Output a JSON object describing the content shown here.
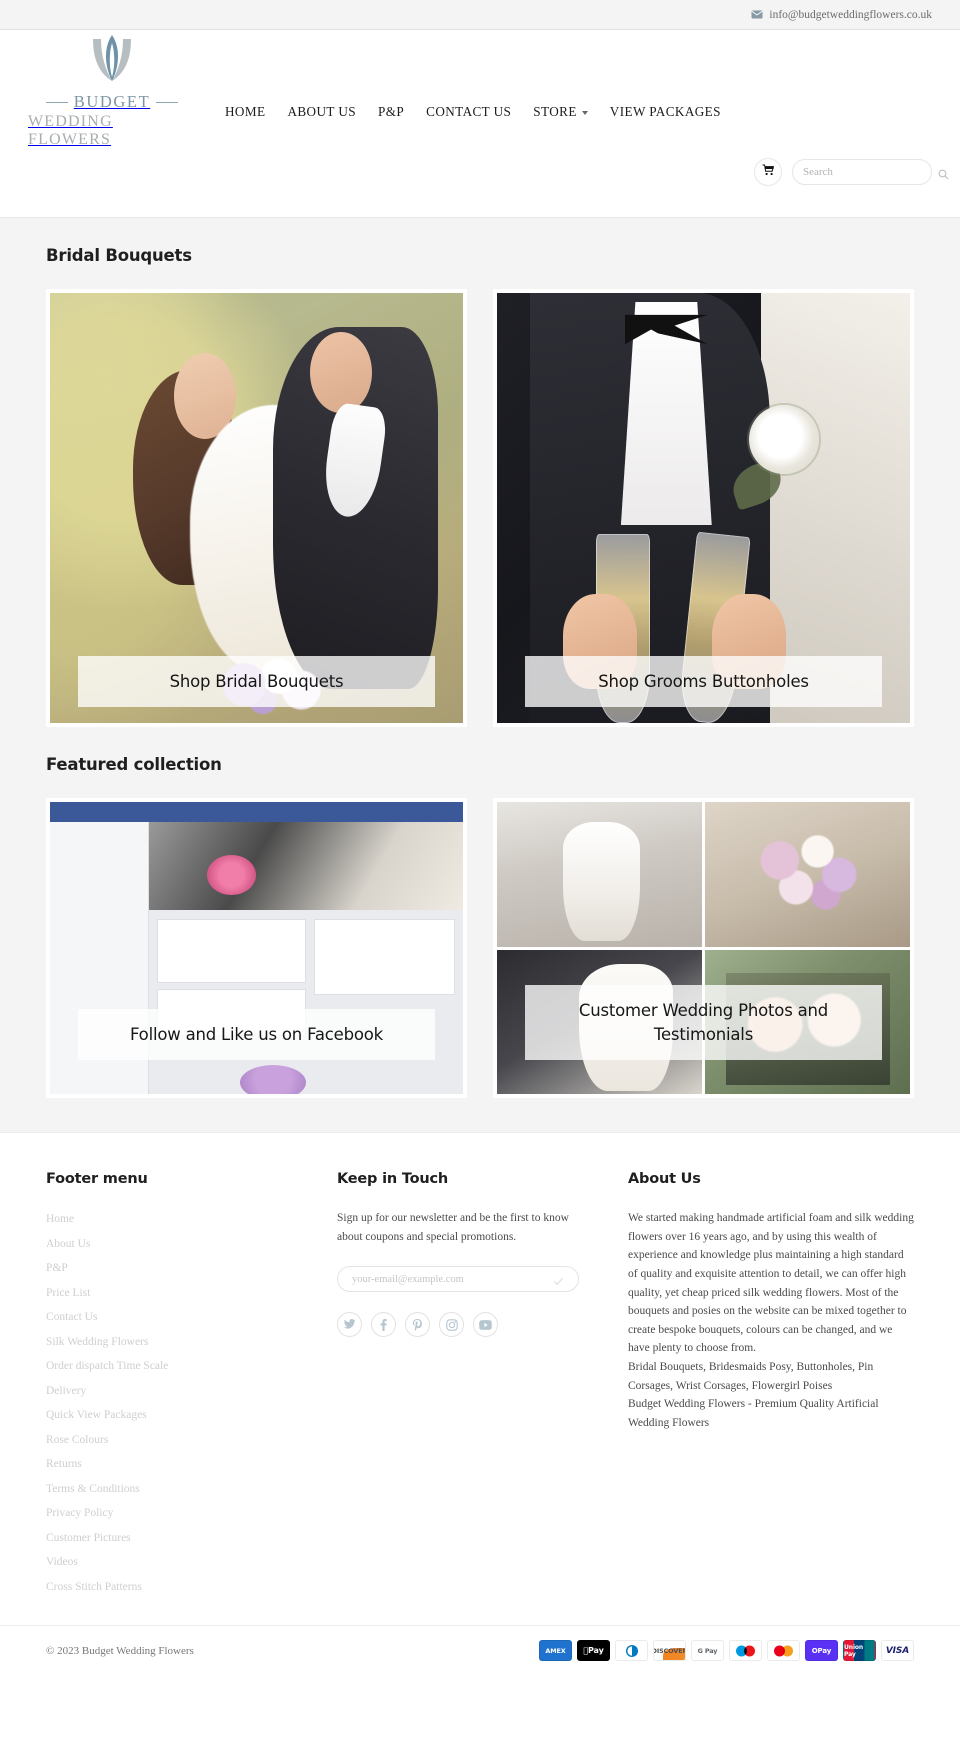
{
  "topbar": {
    "email": "info@budgetweddingflowers.co.uk",
    "mail_icon": "mail-icon"
  },
  "header": {
    "logo": {
      "brand_top": "BUDGET",
      "brand_bottom": "WEDDING FLOWERS",
      "mark": "tulip-flower-logo"
    },
    "nav": [
      {
        "label": "HOME",
        "has_caret": false
      },
      {
        "label": "ABOUT US",
        "has_caret": false
      },
      {
        "label": "P&P",
        "has_caret": false
      },
      {
        "label": "CONTACT US",
        "has_caret": false
      },
      {
        "label": "STORE",
        "has_caret": true
      },
      {
        "label": "VIEW PACKAGES",
        "has_caret": false
      }
    ],
    "cart_icon": "shopping-cart-icon",
    "search": {
      "placeholder": "Search",
      "value": "",
      "icon": "search-icon"
    }
  },
  "main": {
    "section_one_title": "Bridal Bouquets",
    "section_two_title": "Featured collection",
    "cards_top": [
      {
        "caption": "Shop Bridal Bouquets",
        "image": "bride-and-groom-embracing-photo"
      },
      {
        "caption": "Shop Grooms Buttonholes",
        "image": "groom-buttonhole-champagne-photo"
      }
    ],
    "cards_bottom": [
      {
        "caption": "Follow and Like us on Facebook",
        "image": "facebook-page-screenshot"
      },
      {
        "caption": "Customer Wedding Photos and Testimonials",
        "image": "customer-wedding-photo-grid"
      }
    ]
  },
  "footer": {
    "menu_title": "Footer menu",
    "menu_items": [
      "Home",
      "About Us",
      "P&P",
      "Price List",
      "Contact Us",
      "Silk Wedding Flowers",
      "Order dispatch Time Scale",
      "Delivery",
      "Quick View Packages",
      "Rose Colours",
      "Returns",
      "Terms & Conditions",
      "Privacy Policy",
      "Customer Pictures",
      "Videos",
      "Cross Stitch Patterns"
    ],
    "touch_title": "Keep in Touch",
    "touch_text": "Sign up for our newsletter and be the first to know about coupons and special promotions.",
    "newsletter_placeholder": "your-email@example.com",
    "newsletter_value": "",
    "newsletter_submit_icon": "check-icon",
    "socials": [
      {
        "name": "twitter-icon",
        "glyph": "twitter"
      },
      {
        "name": "facebook-icon",
        "glyph": "facebook"
      },
      {
        "name": "pinterest-icon",
        "glyph": "pinterest"
      },
      {
        "name": "instagram-icon",
        "glyph": "instagram"
      },
      {
        "name": "youtube-icon",
        "glyph": "youtube"
      }
    ],
    "about_title": "About Us",
    "about_paragraph_1": "We started making handmade artificial foam and silk wedding flowers over 16 years ago, and by using this wealth of experience and knowledge plus maintaining a high standard of quality and exquisite attention to detail, we can offer high quality, yet cheap priced silk wedding flowers. Most of the bouquets and posies on the website can be mixed together to create bespoke bouquets, colours can be changed, and we have plenty to choose from.",
    "about_paragraph_2": "Bridal Bouquets, Bridesmaids Posy, Buttonholes, Pin Corsages, Wrist Corsages, Flowergirl Poises",
    "about_paragraph_3": "Budget Wedding Flowers - Premium Quality Artificial Wedding Flowers"
  },
  "bottombar": {
    "copyright": "© 2023 Budget Wedding Flowers",
    "payments": [
      {
        "name": "amex",
        "label": "AMEX"
      },
      {
        "name": "apple-pay",
        "label": "Pay"
      },
      {
        "name": "diners-club",
        "label": ""
      },
      {
        "name": "discover",
        "label": "DISCOVER"
      },
      {
        "name": "google-pay",
        "label": "G Pay"
      },
      {
        "name": "maestro",
        "label": ""
      },
      {
        "name": "mastercard",
        "label": ""
      },
      {
        "name": "shop-pay",
        "label": "OPay"
      },
      {
        "name": "union-pay",
        "label": "Union Pay"
      },
      {
        "name": "visa",
        "label": "VISA"
      }
    ]
  },
  "colors": {
    "accent": "#7d96a3",
    "page_bg": "#f4f4f4",
    "topbar_bg": "#f4f4f4",
    "text": "#1f1f1f",
    "muted": "#cfcfcf"
  }
}
